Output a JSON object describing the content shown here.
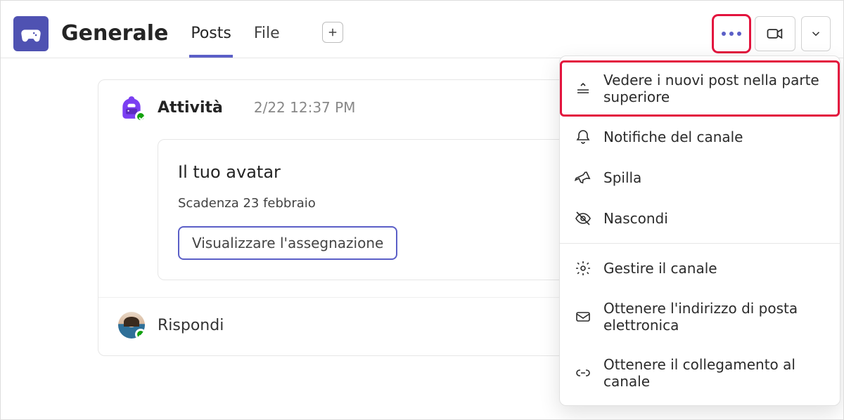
{
  "header": {
    "channel_name": "Generale",
    "tabs": {
      "posts": "Posts",
      "file": "File"
    }
  },
  "post": {
    "author": "Attività",
    "timestamp": "2/22 12:37 PM",
    "card": {
      "title": "Il tuo avatar",
      "due": "Scadenza 23 febbraio",
      "button": "Visualizzare l'assegnazione"
    },
    "reply_label": "Rispondi"
  },
  "menu": {
    "items": {
      "newest_top": "Vedere i nuovi post nella parte superiore",
      "notifications": "Notifiche del canale",
      "pin": "Spilla",
      "hide": "Nascondi",
      "manage": "Gestire il canale",
      "get_email": "Ottenere l'indirizzo di posta elettronica",
      "get_link": "Ottenere il collegamento al canale"
    }
  }
}
